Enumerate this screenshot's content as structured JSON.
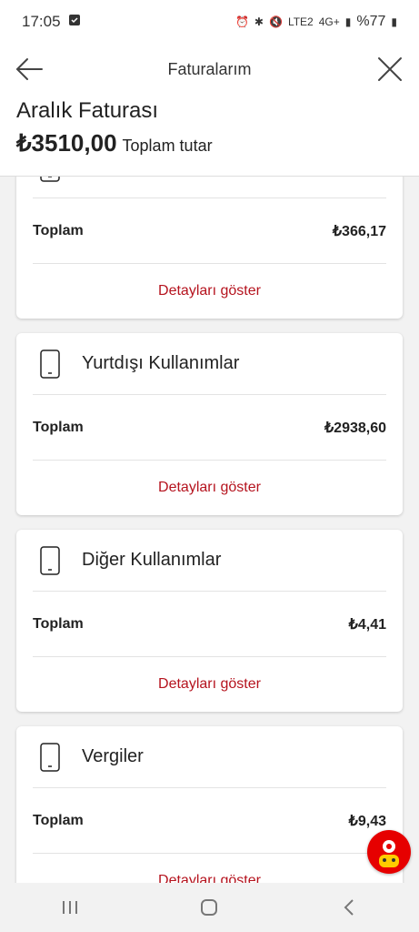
{
  "status": {
    "time": "17:05",
    "battery": "%77",
    "network": "4G+",
    "lte": "LTE2"
  },
  "appbar": {
    "title": "Faturalarım"
  },
  "header": {
    "bill_title": "Aralık Faturası",
    "amount": "₺3510,00",
    "amount_label": "Toplam tutar"
  },
  "cards": [
    {
      "title": "",
      "total_label": "Toplam",
      "total_value": "₺366,17",
      "details_label": "Detayları göster"
    },
    {
      "title": "Yurtdışı Kullanımlar",
      "total_label": "Toplam",
      "total_value": "₺2938,60",
      "details_label": "Detayları göster"
    },
    {
      "title": "Diğer Kullanımlar",
      "total_label": "Toplam",
      "total_value": "₺4,41",
      "details_label": "Detayları göster"
    },
    {
      "title": "Vergiler",
      "total_label": "Toplam",
      "total_value": "₺9,43",
      "details_label": "Detayları göster"
    }
  ],
  "icons": {
    "back": "arrow-left-icon",
    "close": "close-icon",
    "phone": "phone-icon"
  },
  "colors": {
    "accent": "#b5131e",
    "brand": "#e60000"
  }
}
